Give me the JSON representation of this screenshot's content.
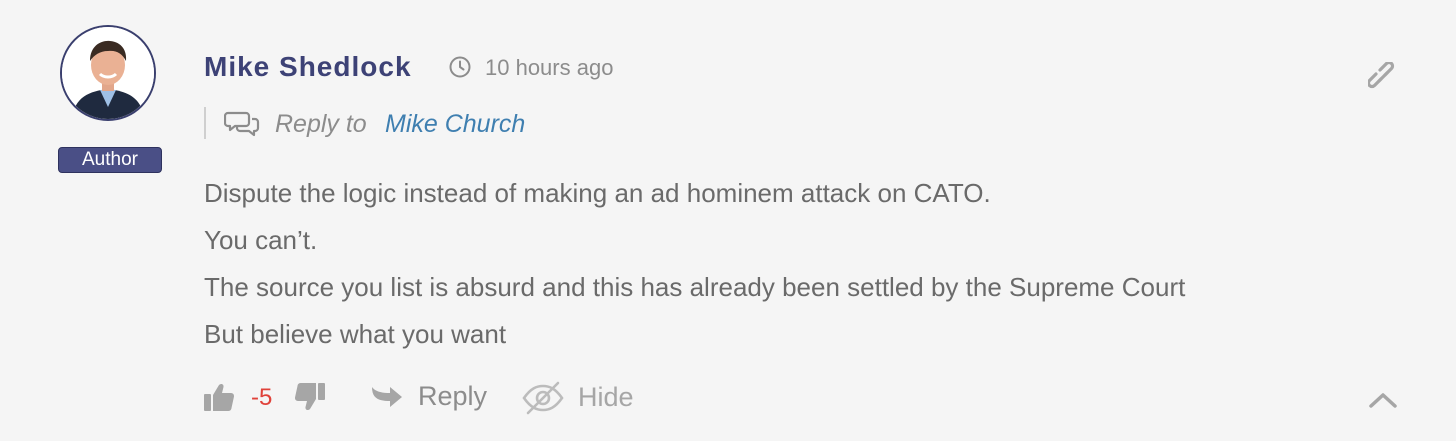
{
  "comment": {
    "author": {
      "name": "Mike Shedlock",
      "badge": "Author"
    },
    "timestamp": "10 hours ago",
    "reply_to": {
      "prefix": "Reply to",
      "name": "Mike Church"
    },
    "body_lines": [
      "Dispute the logic instead of making an ad hominem attack on CATO.",
      "You can’t.",
      "The source you list is absurd and this has already been settled by the Supreme Court",
      "But believe what you want"
    ],
    "actions": {
      "vote_count": "-5",
      "reply_label": "Reply",
      "hide_label": "Hide"
    }
  },
  "icons": {
    "clock": "clock-icon",
    "permalink": "link-icon",
    "reply_to": "speech-bubbles-icon",
    "upvote": "thumbs-up-icon",
    "downvote": "thumbs-down-icon",
    "reply": "reply-arrow-icon",
    "hide": "eye-slash-icon",
    "collapse": "chevron-up-icon"
  },
  "colors": {
    "author_name": "#3d4276",
    "badge_bg": "#4a4f86",
    "link": "#3f7fb0",
    "vote_negative": "#e0423a",
    "muted_text": "#8c8c8c",
    "background": "#f5f5f5"
  }
}
